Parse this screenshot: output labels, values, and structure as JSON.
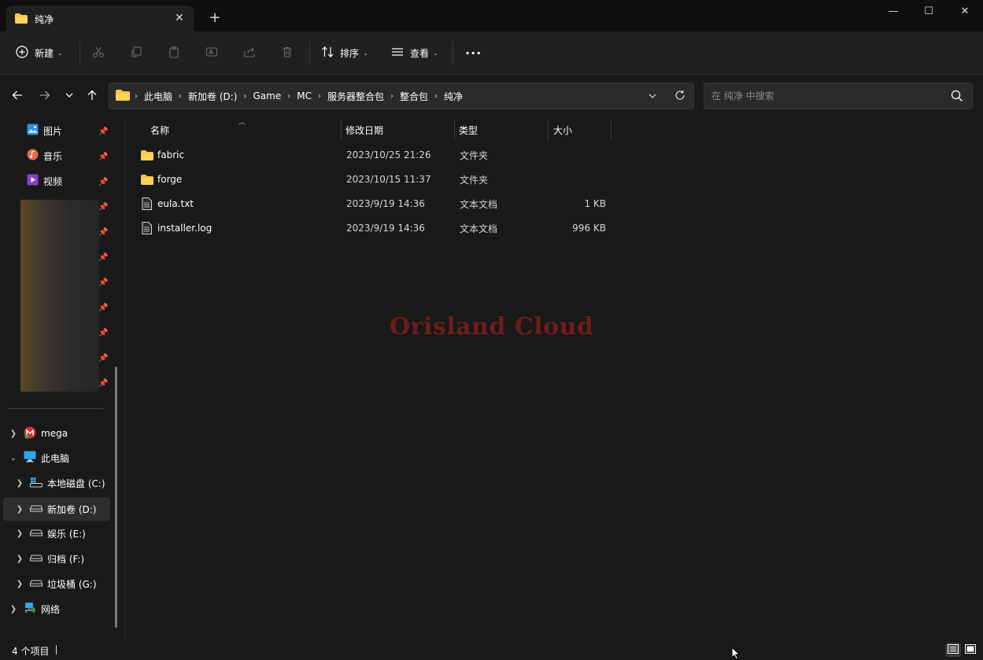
{
  "window": {
    "tab_title": "纯净",
    "tab_close": "✕",
    "new_tab": "+",
    "minimize": "—",
    "maximize": "☐",
    "close": "✕"
  },
  "toolbar": {
    "new_label": "新建",
    "sort_label": "排序",
    "view_label": "查看",
    "more_label": "···"
  },
  "address": {
    "breadcrumbs": [
      "此电脑",
      "新加卷 (D:)",
      "Game",
      "MC",
      "服务器整合包",
      "整合包",
      "纯净"
    ],
    "search_placeholder": "在 纯净 中搜索"
  },
  "sidebar": {
    "quick_access": [
      {
        "label": "图片",
        "icon": "pictures-icon"
      },
      {
        "label": "音乐",
        "icon": "music-icon"
      },
      {
        "label": "视频",
        "icon": "videos-icon"
      }
    ],
    "tree": [
      {
        "label": "mega",
        "icon": "mega-icon",
        "expanded": false
      },
      {
        "label": "此电脑",
        "icon": "this-pc-icon",
        "expanded": true
      },
      {
        "label": "本地磁盘 (C:)",
        "icon": "windows-drive-icon"
      },
      {
        "label": "新加卷 (D:)",
        "icon": "drive-icon",
        "selected": true
      },
      {
        "label": "娱乐 (E:)",
        "icon": "drive-icon"
      },
      {
        "label": "归档 (F:)",
        "icon": "drive-icon"
      },
      {
        "label": "垃圾桶 (G:)",
        "icon": "drive-icon"
      },
      {
        "label": "网络",
        "icon": "network-icon",
        "expanded": false
      }
    ]
  },
  "columns": {
    "name": "名称",
    "modified": "修改日期",
    "type": "类型",
    "size": "大小"
  },
  "files": [
    {
      "name": "fabric",
      "modified": "2023/10/25 21:26",
      "type": "文件夹",
      "size": "",
      "icon": "folder-icon"
    },
    {
      "name": "forge",
      "modified": "2023/10/15 11:37",
      "type": "文件夹",
      "size": "",
      "icon": "folder-icon"
    },
    {
      "name": "eula.txt",
      "modified": "2023/9/19 14:36",
      "type": "文本文档",
      "size": "1 KB",
      "icon": "text-file-icon"
    },
    {
      "name": "installer.log",
      "modified": "2023/9/19 14:36",
      "type": "文本文档",
      "size": "996 KB",
      "icon": "text-file-icon"
    }
  ],
  "watermark": "Orisland Cloud",
  "status": {
    "item_count": "4 个项目"
  },
  "colors": {
    "folder": "#f6c443",
    "background": "#191919",
    "watermark": "#6d1c1c"
  }
}
